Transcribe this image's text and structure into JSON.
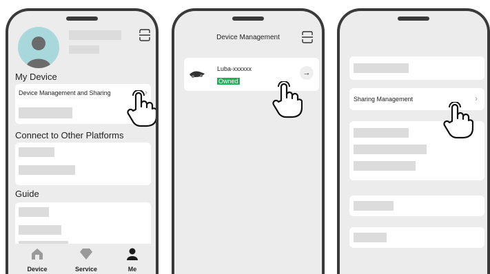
{
  "screen1": {
    "section_my_device": "My Device",
    "device_mgmt_item": "Device Management and Sharing",
    "chevron": "›",
    "section_connect": "Connect to Other Platforms",
    "section_guide": "Guide",
    "nav": [
      {
        "label": "Device",
        "icon": "home-icon"
      },
      {
        "label": "Service",
        "icon": "diamond-icon"
      },
      {
        "label": "Me",
        "icon": "person-icon"
      }
    ]
  },
  "screen2": {
    "title": "Device Management",
    "device_name": "Luba-xxxxxx",
    "device_status": "Owned",
    "arrow": "→"
  },
  "screen3": {
    "sharing_item": "Sharing Management",
    "chevron": "›"
  },
  "colors": {
    "frame": "#3a3a3a",
    "background": "#ececec",
    "placeholder": "#dcdcdc",
    "owned": "#1fb05a",
    "avatar": "#a9d8dc"
  }
}
